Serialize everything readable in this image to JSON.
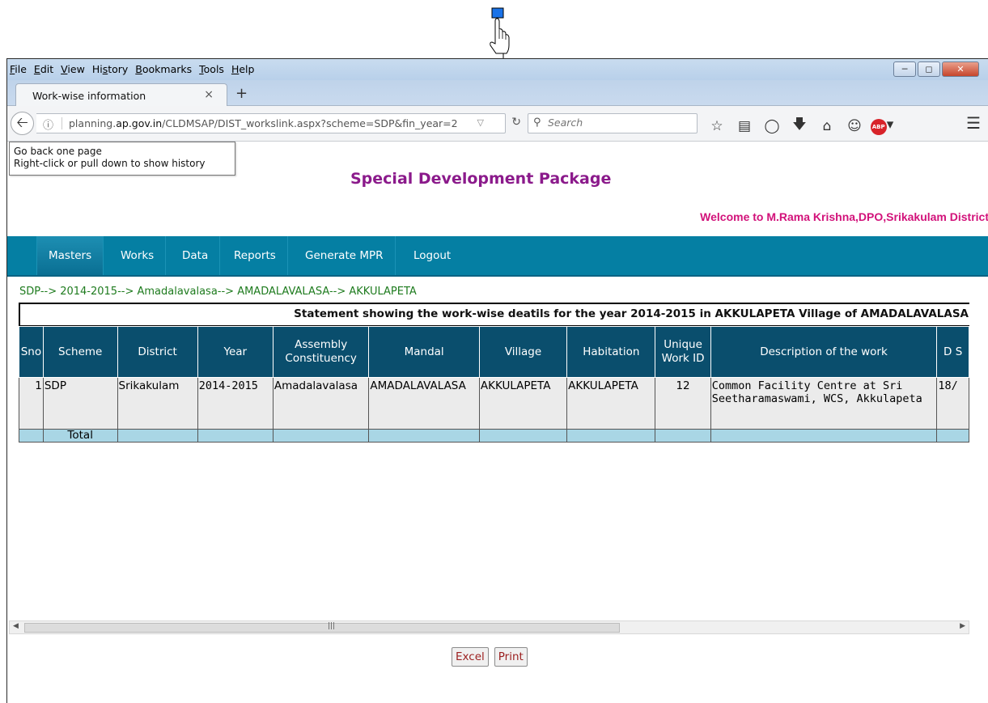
{
  "menubar": {
    "items": [
      {
        "u": "F",
        "rest": "ile"
      },
      {
        "u": "E",
        "rest": "dit"
      },
      {
        "u": "V",
        "rest": "iew"
      },
      {
        "pre": "Hi",
        "u": "s",
        "rest": "tory"
      },
      {
        "u": "B",
        "rest": "ookmarks"
      },
      {
        "u": "T",
        "rest": "ools"
      },
      {
        "u": "H",
        "rest": "elp"
      }
    ]
  },
  "tab": {
    "title": "Work-wise information",
    "close": "×",
    "new": "+"
  },
  "nav": {
    "url_prefix": "planning.",
    "url_domain": "ap.gov.in",
    "url_path": "/CLDMSAP/DIST_workslink.aspx?scheme=SDP&fin_year=2",
    "search_placeholder": "Search"
  },
  "tooltip": {
    "line1": "Go back one page",
    "line2": "Right-click or pull down to show history"
  },
  "page": {
    "title": "Special Development Package",
    "welcome": "Welcome to M.Rama Krishna,DPO,Srikakulam District",
    "menu": [
      "Masters",
      "Works",
      "Data",
      "Reports",
      "Generate MPR",
      "Logout"
    ],
    "breadcrumb": "SDP--> 2014-2015--> Amadalavalasa--> AMADALAVALASA--> AKKULAPETA",
    "statement": "Statement showing the work-wise deatils for the year 2014-2015 in AKKULAPETA Village of AMADALAVALASA"
  },
  "table": {
    "headers": [
      "Sno",
      "Scheme",
      "District",
      "Year",
      "Assembly Constituency",
      "Mandal",
      "Village",
      "Habitation",
      "Unique Work ID",
      "Description of the work",
      "D S"
    ],
    "row": {
      "sno": "1",
      "scheme": "SDP",
      "district": "Srikakulam",
      "year": "2014-2015",
      "assembly": "Amadalavalasa",
      "mandal": "AMADALAVALASA",
      "village": "AKKULAPETA",
      "habitation": "AKKULAPETA",
      "work_id": "12",
      "description": "Common Facility Centre at Sri Seetharamaswami, WCS, Akkulapeta",
      "date": "18/"
    },
    "total_label": "Total"
  },
  "buttons": {
    "excel": "Excel",
    "print": "Print"
  }
}
